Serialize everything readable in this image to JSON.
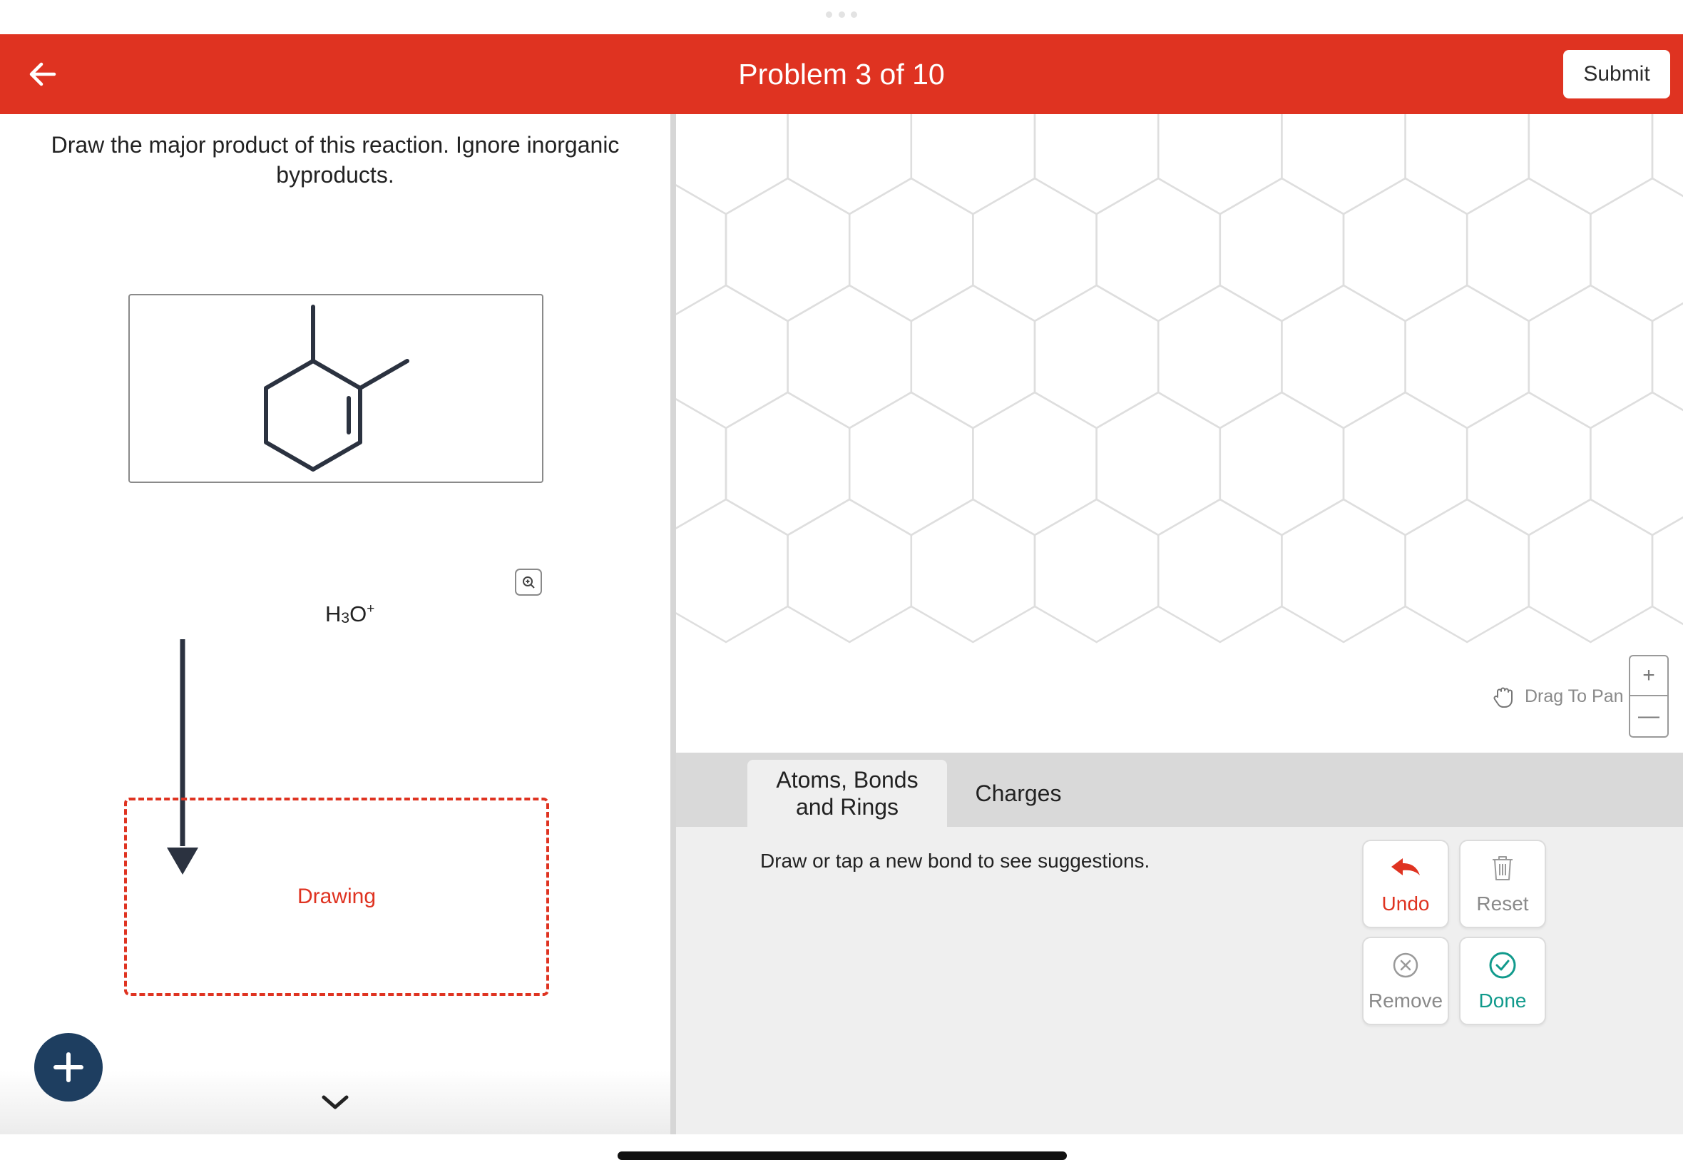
{
  "header": {
    "title": "Problem 3 of 10",
    "submit_label": "Submit"
  },
  "question": {
    "prompt": "Draw the major product of this reaction. Ignore inorganic byproducts.",
    "reagent": {
      "base": "H",
      "sub": "3",
      "mid": "O",
      "sup": "+"
    },
    "product_placeholder": "Drawing"
  },
  "canvas": {
    "pan_hint": "Drag To Pan",
    "zoom_in": "+",
    "zoom_out": "—"
  },
  "tabs": [
    {
      "label": "Atoms, Bonds and Rings",
      "active": true
    },
    {
      "label": "Charges",
      "active": false
    }
  ],
  "tools": {
    "hint": "Draw or tap a new bond to see suggestions.",
    "undo": "Undo",
    "reset": "Reset",
    "remove": "Remove",
    "done": "Done"
  },
  "colors": {
    "brand": "#df3321",
    "fab": "#1e3e60",
    "done": "#119a8c",
    "muted": "#8a8a8a"
  }
}
